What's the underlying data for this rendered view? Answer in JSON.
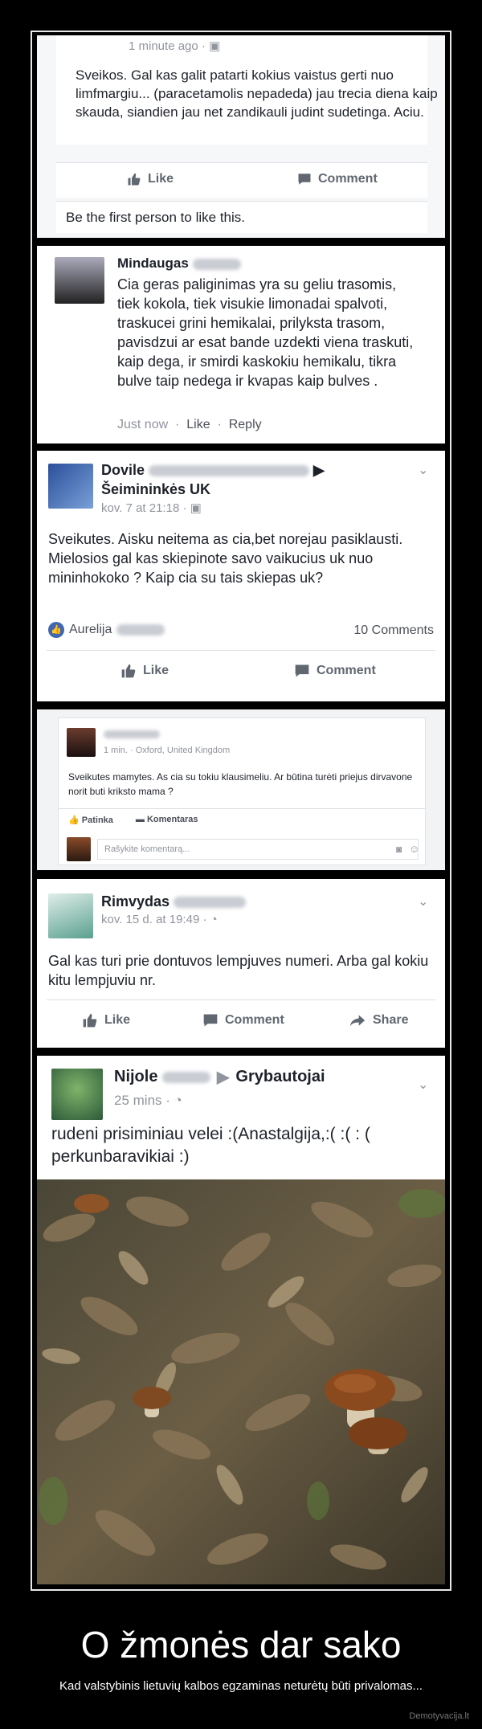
{
  "colors": {
    "fb_blue": "#4267b2",
    "accent_link": "#385898",
    "background": "#000000"
  },
  "post1": {
    "time": "1 minute ago",
    "privacy_icon": "globe-icon",
    "text": "Sveikos. Gal kas galit patarti kokius vaistus gerti nuo limfmargiu... (paracetamolis nepadeda) jau trecia diena kaip skauda, siandien jau net zandikauli judint sudetinga. Aciu.",
    "like_label": "Like",
    "comment_label": "Comment",
    "first_like": "Be the first person to like this."
  },
  "post2": {
    "name": "Mindaugas",
    "text": "Cia geras paliginimas yra su geliu trasomis, tiek kokola, tiek visukie limonadai spalvoti, traskucei grini hemikalai, prilyksta trasom, pavisdzui ar esat bande uzdekti viena traskuti, kaip dega, ir smirdi kaskokiu hemikalu, tikra bulve taip nedega ir kvapas kaip bulves .",
    "time": "Just now",
    "like": "Like",
    "reply": "Reply"
  },
  "post3": {
    "name": "Dovile",
    "group": "Šeimininkės UK",
    "time": "kov. 7 at 21:18",
    "text": "Sveikutes. Aisku neitema as cia,bet norejau pasiklausti. Mielosios gal kas skiepinote savo vaikucius uk nuo mininhokoko ? Kaip cia su tais skiepas uk?",
    "reactor": "Aurelija",
    "comments": "10 Comments",
    "like_label": "Like",
    "comment_label": "Comment"
  },
  "post4": {
    "time": "1 min.",
    "location": "Oxford, United Kingdom",
    "text": "Sveikutes mamytes. As cia su tokiu klausimeliu. Ar būtina turėti priejus dirvavone norit buti kriksto mama ?",
    "like_label": "Patinka",
    "comment_label": "Komentaras",
    "input_placeholder": "Rašykite komentarą..."
  },
  "post5": {
    "name": "Rimvydas",
    "time": "kov. 15 d. at 19:49",
    "text": "Gal kas turi prie dontuvos lempjuves numeri. Arba gal kokiu kitu lempjuviu nr.",
    "like_label": "Like",
    "comment_label": "Comment",
    "share_label": "Share"
  },
  "post6": {
    "name": "Nijole",
    "group": "Grybautojai",
    "time": "25 mins",
    "text": "rudeni prisiminiau velei :(Anastalgija,:( :( : ( perkunbaravikiai :)"
  },
  "caption": {
    "title": "O žmonės dar sako",
    "subtitle": "Kad valstybinis lietuvių kalbos egzaminas neturėtų būti privalomas...",
    "site": "Demotyvacija.lt"
  }
}
